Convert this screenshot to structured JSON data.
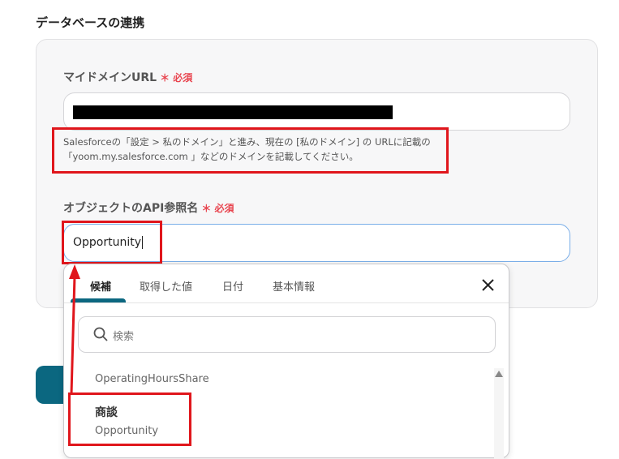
{
  "section_title": "データベースの連携",
  "domain_field": {
    "label": "マイドメインURL",
    "required": "必須",
    "value_redacted": true,
    "help": [
      "Salesforceの「設定 > 私のドメイン」と進み、現在の [私のドメイン] の URLに記載の",
      "「yoom.my.salesforce.com 」などのドメインを記載してください。"
    ]
  },
  "object_field": {
    "label": "オブジェクトのAPI参照名",
    "required": "必須",
    "value": "Opportunity"
  },
  "dropdown": {
    "tabs": [
      {
        "label": "候補",
        "active": true
      },
      {
        "label": "取得した値"
      },
      {
        "label": "日付"
      },
      {
        "label": "基本情報"
      }
    ],
    "close_icon": "close-icon",
    "search_placeholder": "検索",
    "items": [
      {
        "subtitle": "OperatingHoursShare"
      },
      {
        "title": "商談",
        "subtitle": "Opportunity"
      }
    ]
  },
  "colors": {
    "accent": "#0b6780",
    "required": "#e8454f",
    "highlight": "#e0161c",
    "focus": "#7aaee8"
  }
}
